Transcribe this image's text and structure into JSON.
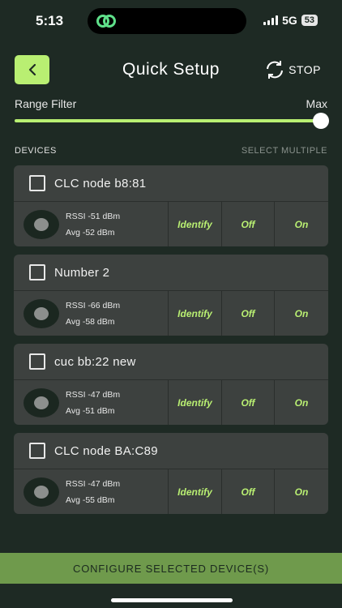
{
  "status_bar": {
    "time": "5:13",
    "network": "5G",
    "battery": "53"
  },
  "header": {
    "title": "Quick Setup",
    "stop_label": "STOP"
  },
  "range_filter": {
    "label": "Range Filter",
    "value_label": "Max",
    "level_percent": 100
  },
  "devices_section": {
    "title": "DEVICES",
    "select_multiple": "SELECT MULTIPLE"
  },
  "devices": [
    {
      "name": "CLC node b8:81",
      "rssi": "RSSI -51  dBm",
      "avg": "Avg -52 dBm"
    },
    {
      "name": "Number 2",
      "rssi": "RSSI -66 dBm",
      "avg": "Avg -58 dBm"
    },
    {
      "name": "cuc bb:22 new",
      "rssi": "RSSI -47  dBm",
      "avg": "Avg -51  dBm"
    },
    {
      "name": "CLC node BA:C89",
      "rssi": "RSSI -47  dBm",
      "avg": "Avg -55 dBm"
    }
  ],
  "actions": {
    "identify": "Identify",
    "off": "Off",
    "on": "On"
  },
  "configure_button": "CONFIGURE SELECTED DEVICE(S)",
  "colors": {
    "accent": "#b9ef72",
    "background": "#1e2a24",
    "card": "#3d413f",
    "configure": "#6f9a4c"
  }
}
